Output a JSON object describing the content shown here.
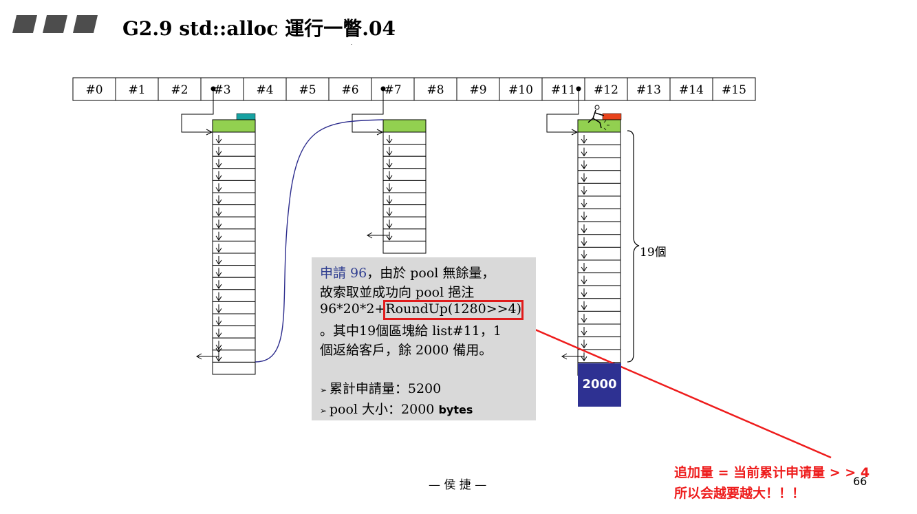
{
  "title": "G2.9 std::alloc 運行一瞥.04",
  "slots": [
    "#0",
    "#1",
    "#2",
    "#3",
    "#4",
    "#5",
    "#6",
    "#7",
    "#8",
    "#9",
    "#10",
    "#11",
    "#12",
    "#13",
    "#14",
    "#15"
  ],
  "info": {
    "line1_prefix": "申請 96",
    "line1_rest": "，由於 pool 無餘量，",
    "line2": "故索取並成功向 pool 挹注",
    "line3_prefix": "96*20*2+",
    "line3_highlight": "RoundUp(1280>>4)",
    "line4": "。其中19個區塊給 list#11，1",
    "line5": "個返給客戶，餘 2000 備用。",
    "bullet1": "累計申請量：5200",
    "bullet2_prefix": "pool 大小：2000 ",
    "bullet2_unit": "bytes"
  },
  "pool_label": "2000",
  "count_label": "19個",
  "footer": "— 侯 捷 —",
  "page_number": "66",
  "note": {
    "line1": "追加量 = 当前累计申请量 > > 4",
    "line2": "所以会越要越大！！！"
  },
  "colors": {
    "green": "#92d050",
    "teal": "#17a2a2",
    "pool_blue": "#2e3192",
    "curve": "#2b2b8c",
    "red": "#ee1c1c",
    "box_gray": "#d9d9d9"
  }
}
